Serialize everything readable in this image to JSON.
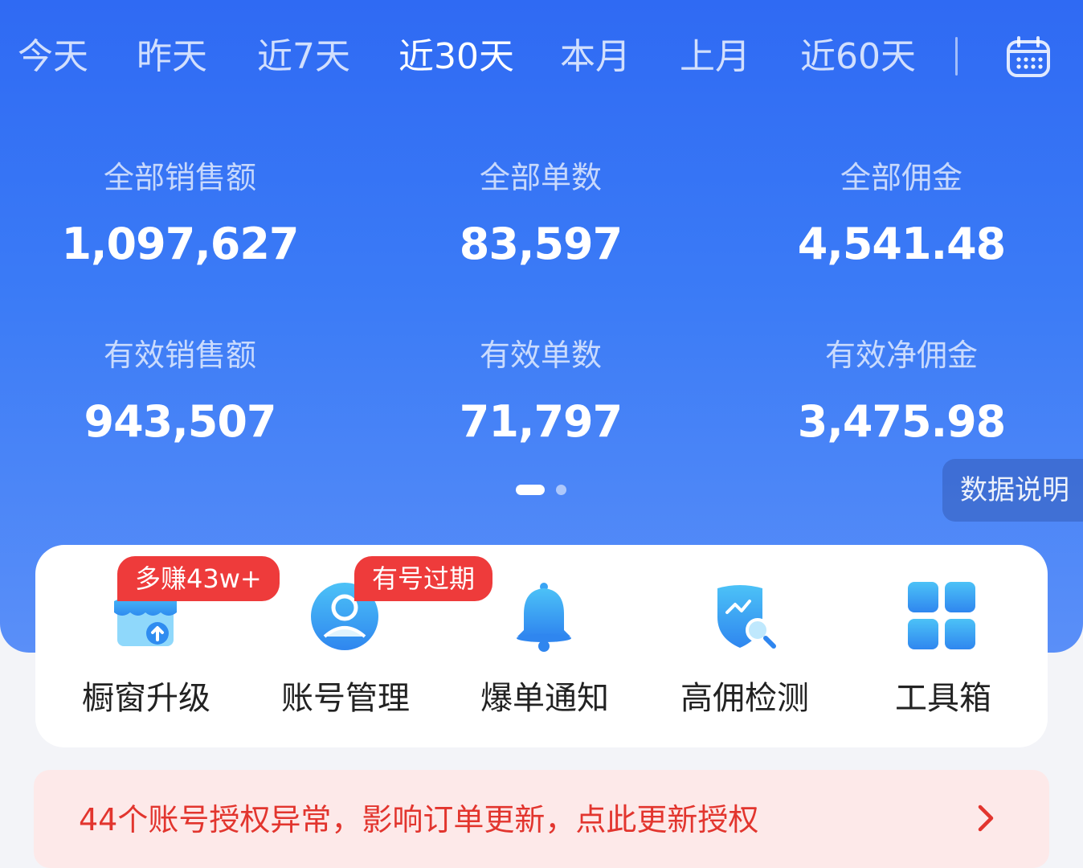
{
  "tabs": {
    "items": [
      {
        "label": "今天"
      },
      {
        "label": "昨天"
      },
      {
        "label": "近7天"
      },
      {
        "label": "近30天"
      },
      {
        "label": "本月"
      },
      {
        "label": "上月"
      },
      {
        "label": "近60天"
      }
    ],
    "active_index": 3,
    "calendar_icon": "calendar-icon"
  },
  "stats": {
    "total_sales_label": "全部销售额",
    "total_sales_value": "1,097,627",
    "total_orders_label": "全部单数",
    "total_orders_value": "83,597",
    "total_commission_label": "全部佣金",
    "total_commission_value": "4,541.48",
    "valid_sales_label": "有效销售额",
    "valid_sales_value": "943,507",
    "valid_orders_label": "有效单数",
    "valid_orders_value": "71,797",
    "valid_net_commission_label": "有效净佣金",
    "valid_net_commission_value": "3,475.98"
  },
  "pager": {
    "pages": 2,
    "current": 1
  },
  "data_explain_label": "数据说明",
  "tools": {
    "items": [
      {
        "label": "橱窗升级",
        "icon": "storefront-upgrade-icon",
        "badge": "多赚43w+"
      },
      {
        "label": "账号管理",
        "icon": "user-account-icon",
        "badge": "有号过期"
      },
      {
        "label": "爆单通知",
        "icon": "bell-icon"
      },
      {
        "label": "高佣检测",
        "icon": "shield-search-icon"
      },
      {
        "label": "工具箱",
        "icon": "grid-apps-icon"
      }
    ]
  },
  "notice": {
    "text": "44个账号授权异常，影响订单更新，点此更新授权",
    "arrow_icon": "chevron-right-icon"
  },
  "colors": {
    "hero_blue": "#2f6af3",
    "badge_red": "#ee3b3b",
    "notice_bg": "#fde9e9",
    "notice_text": "#e2352e"
  }
}
